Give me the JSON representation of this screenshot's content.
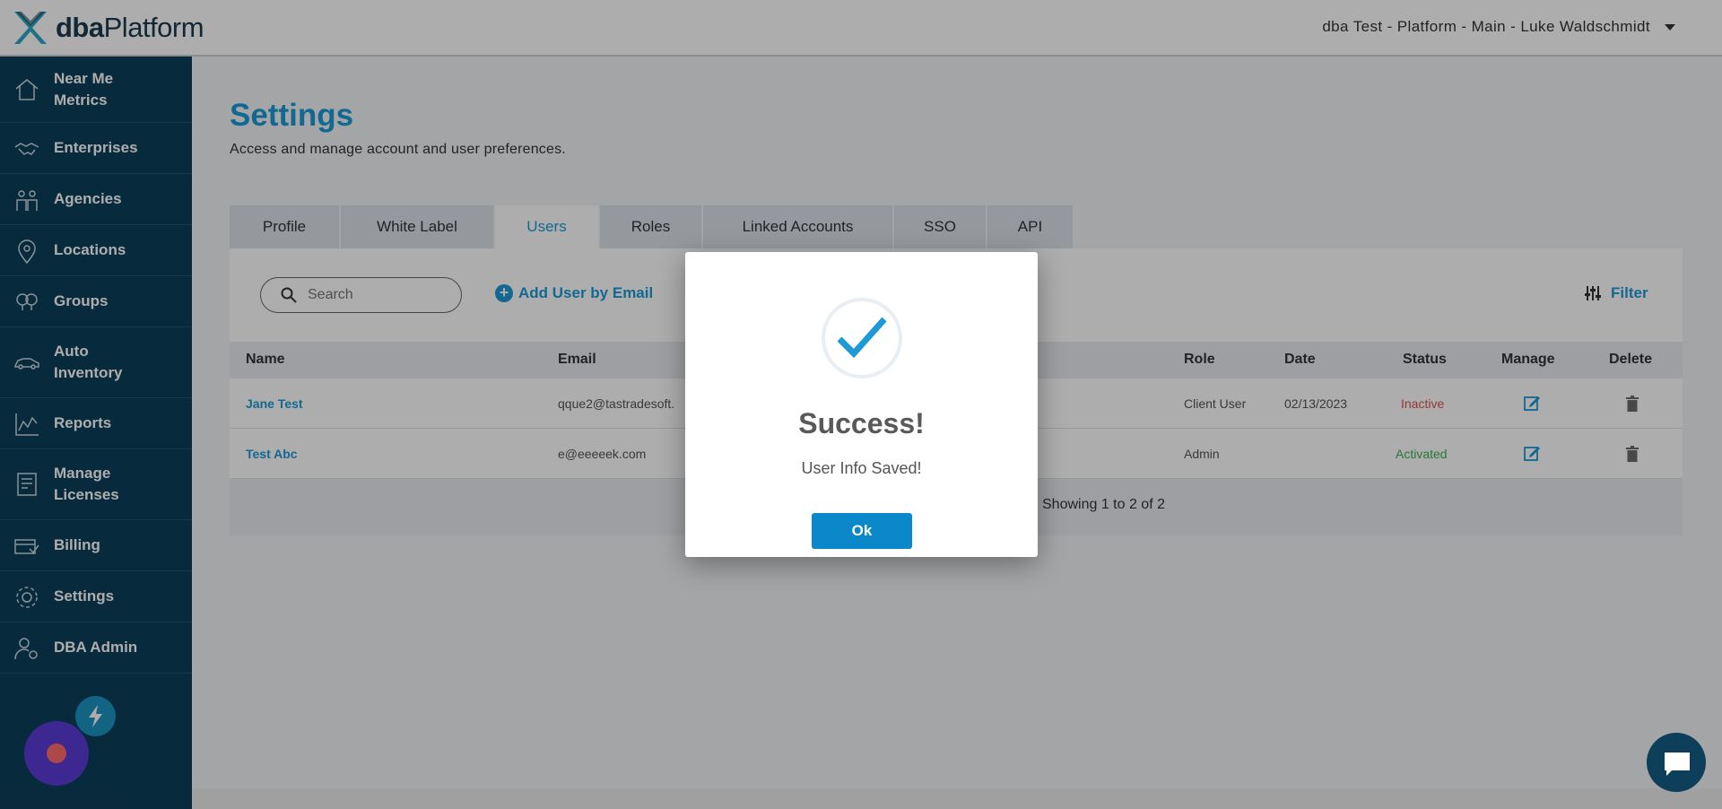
{
  "header": {
    "logo_bold": "dba",
    "logo_light": "Platform",
    "account": "dba Test - Platform - Main - Luke Waldschmidt"
  },
  "sidebar": {
    "items": [
      {
        "label_line1": "Near Me",
        "label_line2": "Metrics",
        "icon": "home-icon"
      },
      {
        "label_line1": "Enterprises",
        "label_line2": "",
        "icon": "handshake-icon"
      },
      {
        "label_line1": "Agencies",
        "label_line2": "",
        "icon": "people-icon"
      },
      {
        "label_line1": "Locations",
        "label_line2": "",
        "icon": "map-pin-icon"
      },
      {
        "label_line1": "Groups",
        "label_line2": "",
        "icon": "group-pins-icon"
      },
      {
        "label_line1": "Auto",
        "label_line2": "Inventory",
        "icon": "car-icon"
      },
      {
        "label_line1": "Reports",
        "label_line2": "",
        "icon": "chart-icon"
      },
      {
        "label_line1": "Manage",
        "label_line2": "Licenses",
        "icon": "license-icon"
      },
      {
        "label_line1": "Billing",
        "label_line2": "",
        "icon": "billing-icon"
      },
      {
        "label_line1": "Settings",
        "label_line2": "",
        "icon": "gear-icon"
      },
      {
        "label_line1": "DBA Admin",
        "label_line2": "",
        "icon": "admin-user-icon"
      }
    ]
  },
  "page": {
    "title": "Settings",
    "subtitle": "Access and manage account and user preferences."
  },
  "tabs": [
    "Profile",
    "White Label",
    "Users",
    "Roles",
    "Linked Accounts",
    "SSO",
    "API"
  ],
  "active_tab": "Users",
  "toolbar": {
    "search_placeholder": "Search",
    "add_user_label": "Add User by Email",
    "filter_label": "Filter"
  },
  "table": {
    "columns": [
      "Name",
      "Email",
      "Role",
      "Date",
      "Status",
      "Manage",
      "Delete"
    ],
    "rows": [
      {
        "name": "Jane Test",
        "email": "qque2@tastradesoft.",
        "role": "Client User",
        "date": "02/13/2023",
        "status": "Inactive"
      },
      {
        "name": "Test Abc",
        "email": "e@eeeeek.com",
        "role": "Admin",
        "date": "",
        "status": "Activated"
      }
    ],
    "footer": "Showing 1 to 2 of 2"
  },
  "modal": {
    "title": "Success!",
    "message": "User Info Saved!",
    "ok_label": "Ok"
  },
  "colors": {
    "accent": "#1d9ad6",
    "sidebar": "#0d3e5a",
    "inactive": "#d9534f",
    "activated": "#3fae5a"
  }
}
